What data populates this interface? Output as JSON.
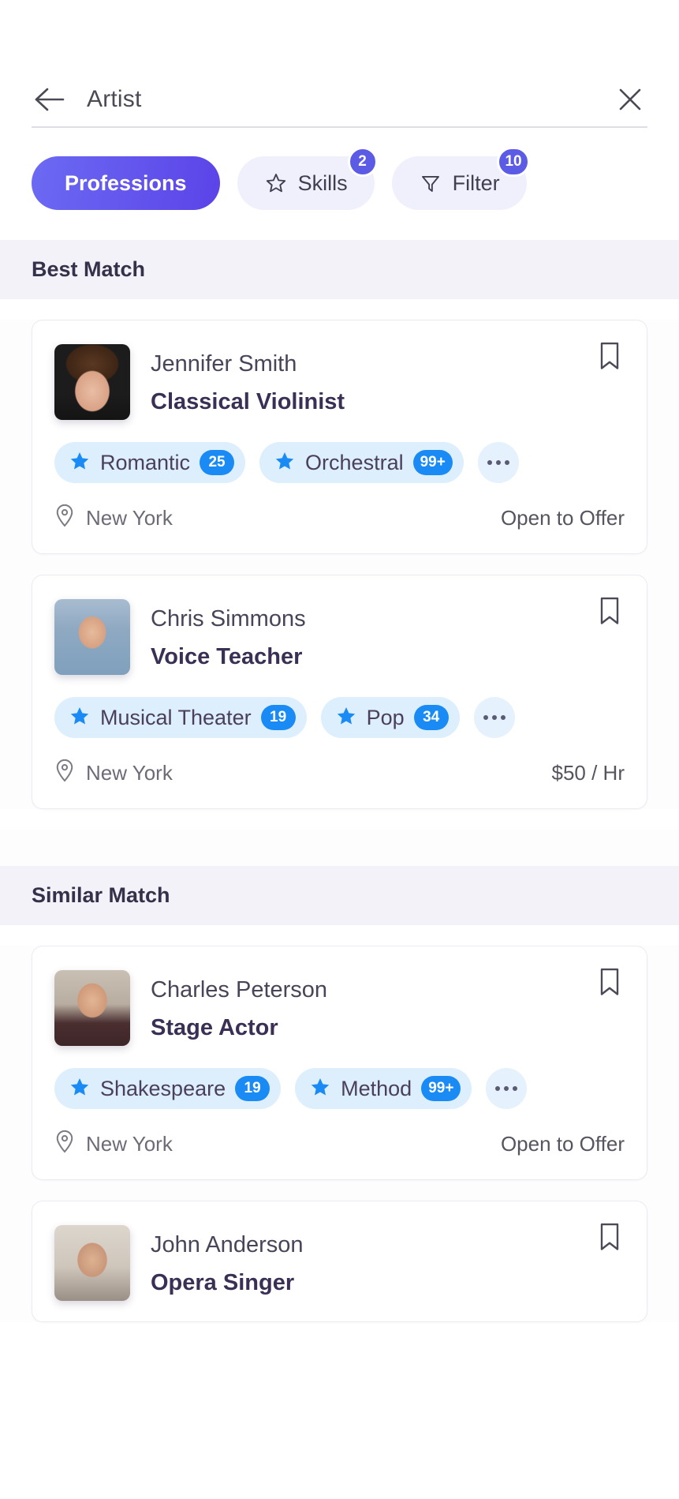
{
  "search": {
    "value": "Artist",
    "back_icon": "arrow-left-icon",
    "clear_icon": "close-icon"
  },
  "chips": [
    {
      "label": "Professions",
      "icon": null,
      "badge": null,
      "active": true
    },
    {
      "label": "Skills",
      "icon": "star-outline-icon",
      "badge": "2",
      "active": false
    },
    {
      "label": "Filter",
      "icon": "funnel-icon",
      "badge": "10",
      "active": false
    }
  ],
  "sections": [
    {
      "title": "Best Match",
      "cards": [
        {
          "name": "Jennifer Smith",
          "role": "Classical Violinist",
          "avatar_class": "av-0",
          "bookmark_icon": "bookmark-icon",
          "tags": [
            {
              "label": "Romantic",
              "count": "25"
            },
            {
              "label": "Orchestral",
              "count": "99+"
            }
          ],
          "more_icon": "ellipsis-icon",
          "location_icon": "location-pin-icon",
          "location": "New York",
          "offer": "Open to Offer"
        },
        {
          "name": "Chris Simmons",
          "role": "Voice Teacher",
          "avatar_class": "av-1",
          "bookmark_icon": "bookmark-icon",
          "tags": [
            {
              "label": "Musical Theater",
              "count": "19"
            },
            {
              "label": "Pop",
              "count": "34"
            }
          ],
          "more_icon": "ellipsis-icon",
          "location_icon": "location-pin-icon",
          "location": "New York",
          "offer": "$50 / Hr"
        }
      ]
    },
    {
      "title": "Similar Match",
      "cards": [
        {
          "name": "Charles Peterson",
          "role": "Stage Actor",
          "avatar_class": "av-2",
          "bookmark_icon": "bookmark-icon",
          "tags": [
            {
              "label": "Shakespeare",
              "count": "19"
            },
            {
              "label": "Method",
              "count": "99+"
            }
          ],
          "more_icon": "ellipsis-icon",
          "location_icon": "location-pin-icon",
          "location": "New York",
          "offer": "Open to Offer"
        },
        {
          "name": "John Anderson",
          "role": "Opera Singer",
          "avatar_class": "av-3",
          "bookmark_icon": "bookmark-icon",
          "tags": [],
          "more_icon": "ellipsis-icon",
          "location_icon": "location-pin-icon",
          "location": "",
          "offer": ""
        }
      ]
    }
  ],
  "colors": {
    "accent_purple": "#5b43e8",
    "tag_blue": "#1a8bf5",
    "tag_bg": "#ddeefd",
    "section_bg": "#f3f2f9"
  }
}
